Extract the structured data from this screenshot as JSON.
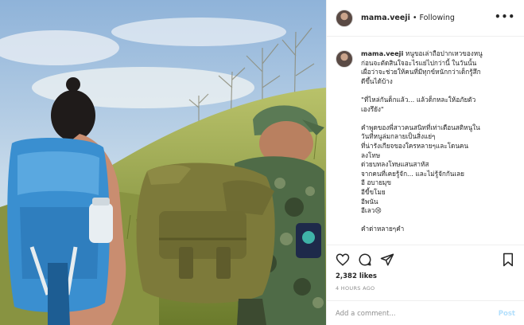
{
  "post": {
    "username": "mama.veeji",
    "separator": "•",
    "follow_status": "Following",
    "more": "•••"
  },
  "caption": {
    "username": "mama.veeji",
    "line1": "หนูขอเล่าถือปากเหวของหนู",
    "lines": [
      "ก่อนจะตัดสินใจอะไรแย่ไปกว่านี้ ในวันนั้น",
      "เผื่อว่าจะช่วยให้คนที่มีทุกข์หนักกว่าเด็กรู้สึก",
      "ดีขึ้นได้บ้าง",
      "",
      "\"ที่ไหล่กันด็กแล้ว... แล้วด็กหละให้อภัยตัว",
      "เองรึยัง\"",
      "",
      "คำพูดของพี่สาวคนสนิทที่เท่าเดือนสติหนูใน",
      "วันที่หนูล่มกลายเป็นสิ่งแย่ๆ",
      "ที่น่ารังเกียจของใครหลายๆและโดนคน",
      "ลงโทษ",
      "ด่วยบทลงโทษแสนสาหัส",
      "จากคนที่เคยรู้จัก... และไม่รู้จักกันเลย",
      "อี อบายมุข",
      "อีขี้ขโมย",
      "อีพนัน",
      "อีเลว😢",
      "",
      "คำด่าหลายๆคำ"
    ]
  },
  "likes": "2,382 likes",
  "time": "4 HOURS AGO",
  "comment_box": {
    "placeholder": "Add a comment...",
    "post_label": "Post"
  },
  "colors": {
    "accent_disabled": "#b2dffc",
    "muted": "#8e8e8e",
    "text": "#262626"
  }
}
